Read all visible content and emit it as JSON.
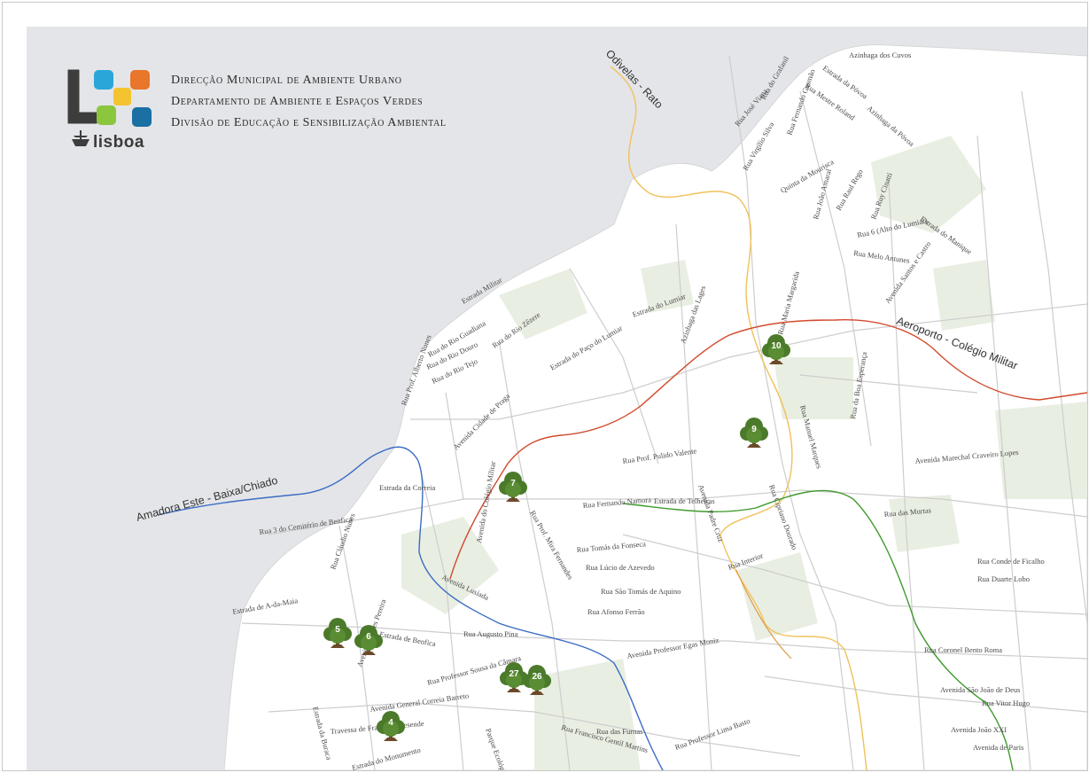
{
  "header": {
    "org_lines": [
      "Direcção Municipal de Ambiente Urbano",
      "Departamento de Ambiente e Espaços Verdes",
      "Divisão de Educação e Sensibilização Ambiental"
    ],
    "logo_word": "lisboa"
  },
  "colors": {
    "water": "#e4e5e8",
    "land": "#ffffff",
    "green_area": "#e9eee2",
    "road": "#c8c8c8",
    "line_red": "#d14a2c",
    "line_blue": "#3b6cc4",
    "line_green": "#3f9a2e",
    "line_yellow": "#f0c15a",
    "tree": "#4b7a2a"
  },
  "transit_lines": [
    {
      "label": "Odivelas - Rato",
      "color": "line_yellow"
    },
    {
      "label": "Aeroporto - Colégio Militar",
      "color": "line_red"
    },
    {
      "label": "Amadora Este - Baixa/Chiado",
      "color": "line_blue"
    }
  ],
  "tree_markers": [
    "10",
    "9",
    "7",
    "5",
    "6",
    "27",
    "26",
    "4"
  ],
  "streets": [
    "Azinhaga dos Cuvos",
    "Estrada da Póvoa",
    "Rua José Viana",
    "Rua do Grafanil",
    "Rua Mestre Roland",
    "Rua Fernando Gusmão",
    "Azinhaga da Póvoa",
    "Rua Virgílio Silva",
    "Quinta da Mourisca",
    "Rua Ruy Cinatti",
    "Rua Raul Rego",
    "Rua João Amaral",
    "Rua 6 (Alto do Lumiar)",
    "Rua Melo Antunes",
    "Estrada do Manique",
    "Estrada Militar",
    "Rua do Rio Zêzere",
    "Rua do Rio Guadiana",
    "Rua do Rio Douro",
    "Rua do Rio Tejo",
    "Rua Prof. Alberto Nunes",
    "Avenida Cidade de Praga",
    "Estrada do Paço do Lumiar",
    "Estrada do Lumiar",
    "Azinhaga das Lages",
    "Rua Maria Margarida",
    "Avenida Santos e Castro",
    "Rua Prof. Pulido Valente",
    "Avenida Padre Cruz",
    "Rua Fernando Namora",
    "Estrada de Telheiras",
    "Rua Manuel Marques",
    "Rua da Boa Esperança",
    "Avenida Marechal Craveiro Lopes",
    "Rua Cipriano Dourado",
    "Rua das Murtas",
    "Rua Tomás da Fonseca",
    "Rua Lúcio de Azevedo",
    "Rua São Tomás de Aquino",
    "Rua Afonso Ferrão",
    "Avenida Professor Egas Moniz",
    "Rua Interior",
    "Rua Conde de Ficalho",
    "Rua Duarte Lobo",
    "Rua Coronel Bento Roma",
    "Avenida São João de Deus",
    "Rua Vitor Hugo",
    "Avenida João XXI",
    "Avenida de Paris",
    "Estrada da Correia",
    "Rua 3 do Cemitério de Benfica",
    "Estrada de A-da-Maia",
    "Estrada de Benfica",
    "Rua Augusto Pina",
    "Avenida Lusíada",
    "Avenida General Correia Barreto",
    "Rua das Furnas",
    "Rua Francisco Gentil Martins",
    "Rua Professor Lima Basto",
    "Estrada do Monumento",
    "Travessa de Francisco Resende",
    "Parque Ecológico",
    "Estrada da Buraca",
    "Avenida Gomes Pereira",
    "Rua Cláudio Nunes",
    "Rua Professor Sousa da Câmara",
    "Avenida do Colégio Militar",
    "Rua Prof. Mira Fernandes"
  ]
}
